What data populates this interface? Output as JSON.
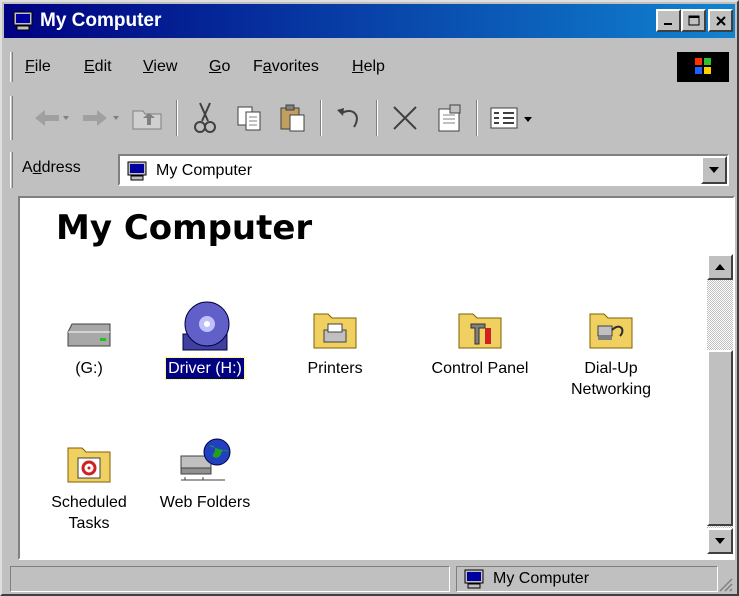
{
  "window": {
    "title": "My Computer"
  },
  "menu": [
    {
      "label": "File",
      "key": "F",
      "rest": "ile"
    },
    {
      "label": "Edit",
      "key": "E",
      "rest": "dit"
    },
    {
      "label": "View",
      "key": "V",
      "rest": "iew"
    },
    {
      "label": "Go",
      "key": "G",
      "rest": "o"
    },
    {
      "label": "Favorites",
      "key": "a",
      "pre": "F",
      "rest": "vorites"
    },
    {
      "label": "Help",
      "key": "H",
      "rest": "elp"
    }
  ],
  "toolbar": {
    "icons": [
      "back-arrow-icon",
      "forward-arrow-icon",
      "up-folder-icon",
      "cut-icon",
      "copy-icon",
      "paste-icon",
      "undo-icon",
      "delete-icon",
      "properties-icon",
      "views-icon"
    ]
  },
  "address": {
    "label_pre": "A",
    "label_key": "d",
    "label_rest": "dress",
    "value": "My Computer"
  },
  "content": {
    "heading": "My Computer",
    "items": [
      {
        "label": "(G:)",
        "icon": "drive-icon",
        "selected": false
      },
      {
        "label": "Driver (H:)",
        "icon": "cd-drive-icon",
        "selected": true
      },
      {
        "label": "Printers",
        "icon": "printers-folder-icon",
        "selected": false
      },
      {
        "label": "Control Panel",
        "icon": "control-panel-folder-icon",
        "selected": false
      },
      {
        "label_line1": "Dial-Up",
        "label_line2": "Networking",
        "icon": "dialup-folder-icon",
        "selected": false
      },
      {
        "label_line1": "Scheduled",
        "label_line2": "Tasks",
        "icon": "scheduled-tasks-folder-icon",
        "selected": false
      },
      {
        "label": "Web Folders",
        "icon": "web-folders-icon",
        "selected": false
      }
    ]
  },
  "status": {
    "text": "My Computer"
  },
  "colors": {
    "titlebar_start": "#000080",
    "titlebar_end": "#1084d0",
    "face": "#c0c0c0",
    "selection": "#000080"
  }
}
